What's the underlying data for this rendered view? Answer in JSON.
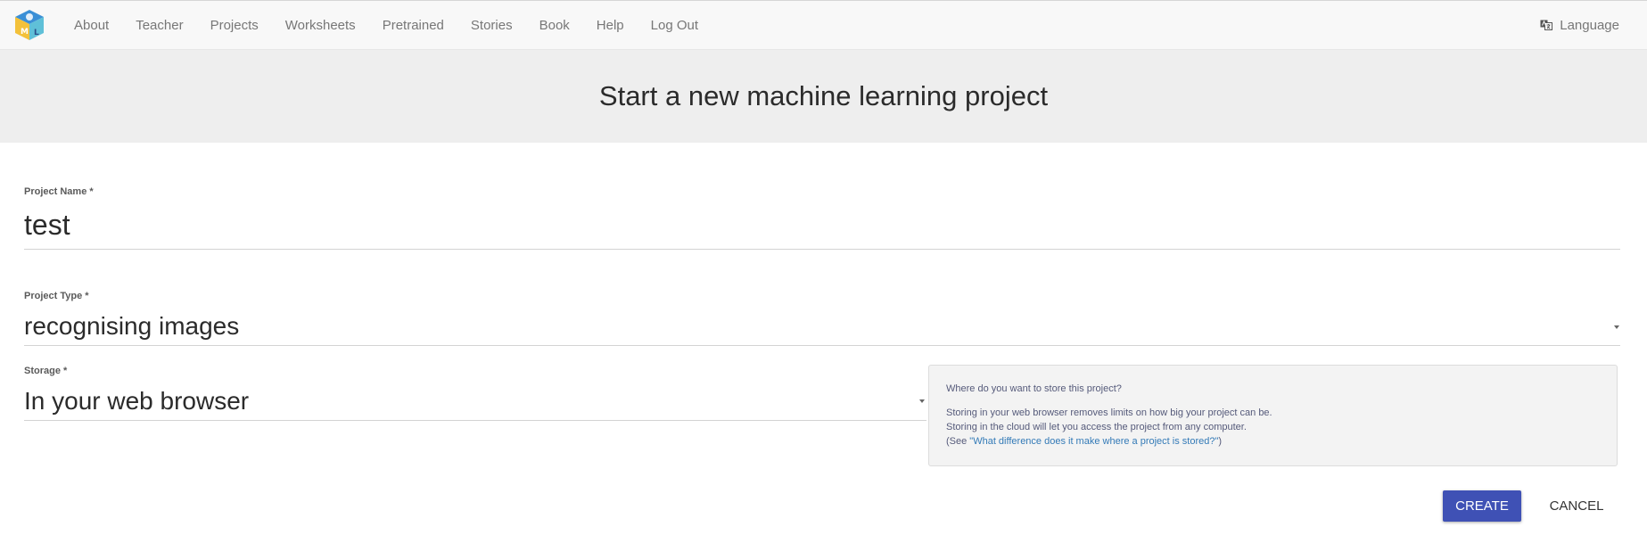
{
  "nav": {
    "logo_icon": "ml-cube-logo-icon",
    "links": [
      "About",
      "Teacher",
      "Projects",
      "Worksheets",
      "Pretrained",
      "Stories",
      "Book",
      "Help",
      "Log Out"
    ],
    "language_label": "Language",
    "language_icon": "translate-icon"
  },
  "header": {
    "title": "Start a new machine learning project"
  },
  "form": {
    "project_name": {
      "label": "Project Name *",
      "value": "test"
    },
    "project_type": {
      "label": "Project Type *",
      "value": "recognising images"
    },
    "storage": {
      "label": "Storage *",
      "value": "In your web browser"
    }
  },
  "help": {
    "question": "Where do you want to store this project?",
    "line1": "Storing in your web browser removes limits on how big your project can be.",
    "line2": "Storing in the cloud will let you access the project from any computer.",
    "line3_prefix": "(See ",
    "line3_link": "\"What difference does it make where a project is stored?\"",
    "line3_suffix": ")"
  },
  "actions": {
    "create_label": "CREATE",
    "cancel_label": "CANCEL"
  },
  "colors": {
    "primary_button": "#3f51b5",
    "link": "#337ab7",
    "header_band": "#eeeeee",
    "navbar": "#f8f8f8"
  }
}
